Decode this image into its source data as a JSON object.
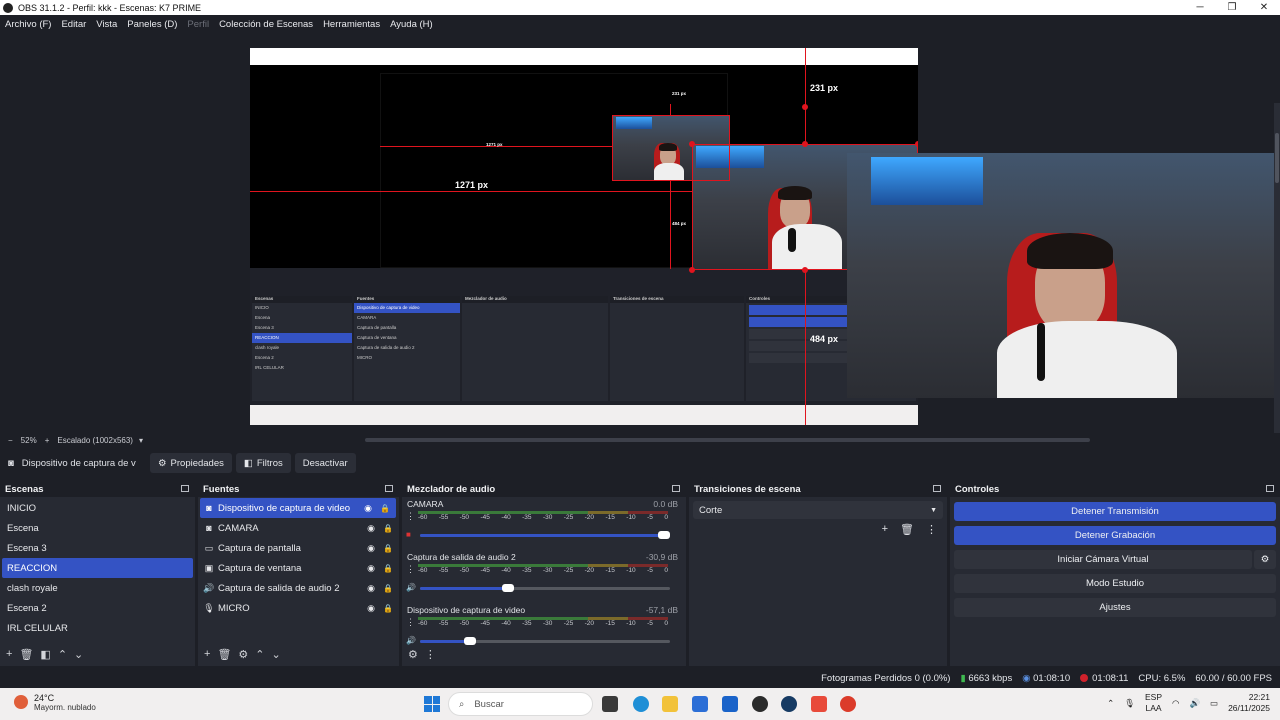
{
  "window": {
    "title": "OBS 31.1.2 - Perfil: kkk - Escenas: K7 PRIME"
  },
  "menu": {
    "items": [
      "Archivo (F)",
      "Editar",
      "Vista",
      "Paneles (D)",
      "Perfil",
      "Colección de Escenas",
      "Herramientas",
      "Ayuda (H)"
    ],
    "disabled_index": 4
  },
  "preview": {
    "measure_h_large": "1271 px",
    "measure_v_top": "231 px",
    "measure_v_bottom": "484 px",
    "nested_measure_h": "1271 px",
    "nested_measure_v_top": "231 px",
    "nested_measure_v_bottom": "484 px"
  },
  "zoom_bar": {
    "minus": "−",
    "zoom": "52%",
    "plus": "+",
    "scaled": "Escalado (1002x563)"
  },
  "source_toolbar": {
    "source_name": "Dispositivo de captura de v",
    "properties": "Propiedades",
    "filters": "Filtros",
    "deactivate": "Desactivar"
  },
  "scenes": {
    "title": "Escenas",
    "items": [
      "INICIO",
      "Escena",
      "Escena 3",
      "REACCION",
      "clash royale",
      "Escena 2",
      "IRL CELULAR"
    ],
    "selected_index": 3
  },
  "sources": {
    "title": "Fuentes",
    "items": [
      {
        "label": "Dispositivo de captura de video",
        "icon": "camera-icon"
      },
      {
        "label": "CAMARA",
        "icon": "camera-icon"
      },
      {
        "label": "Captura de pantalla",
        "icon": "monitor-icon"
      },
      {
        "label": "Captura de ventana",
        "icon": "window-icon"
      },
      {
        "label": "Captura de salida de audio 2",
        "icon": "speaker-icon"
      },
      {
        "label": "MICRO",
        "icon": "microphone-icon"
      }
    ],
    "selected_index": 0
  },
  "mixer": {
    "title": "Mezclador de audio",
    "scale": [
      "-60",
      "-55",
      "-50",
      "-45",
      "-40",
      "-35",
      "-30",
      "-25",
      "-20",
      "-15",
      "-10",
      "-5",
      "0"
    ],
    "channels": [
      {
        "name": "CAMARA",
        "db": "0.0 dB",
        "volume": 1.0,
        "muted": true
      },
      {
        "name": "Captura de salida de audio 2",
        "db": "-30,9 dB",
        "volume": 0.35,
        "muted": false
      },
      {
        "name": "Dispositivo de captura de video",
        "db": "-57,1 dB",
        "volume": 0.2,
        "muted": false
      }
    ]
  },
  "transitions": {
    "title": "Transiciones de escena",
    "selected": "Corte"
  },
  "controls": {
    "title": "Controles",
    "stop_stream": "Detener Transmisión",
    "stop_record": "Detener Grabación",
    "virtual_cam": "Iniciar Cámara Virtual",
    "studio_mode": "Modo Estudio",
    "settings": "Ajustes"
  },
  "status": {
    "dropped": "Fotogramas Perdidos 0 (0.0%)",
    "bitrate": "6663 kbps",
    "stream_time": "01:08:10",
    "rec_time": "01:08:11",
    "cpu": "CPU: 6.5%",
    "fps": "60.00 / 60.00 FPS"
  },
  "taskbar": {
    "temp": "24°C",
    "weather": "Mayorm. nublado",
    "search": "Buscar",
    "lang1": "ESP",
    "lang2": "LAA",
    "time": "22:21",
    "date": "26/11/2025"
  },
  "colors": {
    "accent": "#3453c4",
    "measure": "#e0141e",
    "bg": "#1d1f26",
    "panel": "#272a33"
  }
}
